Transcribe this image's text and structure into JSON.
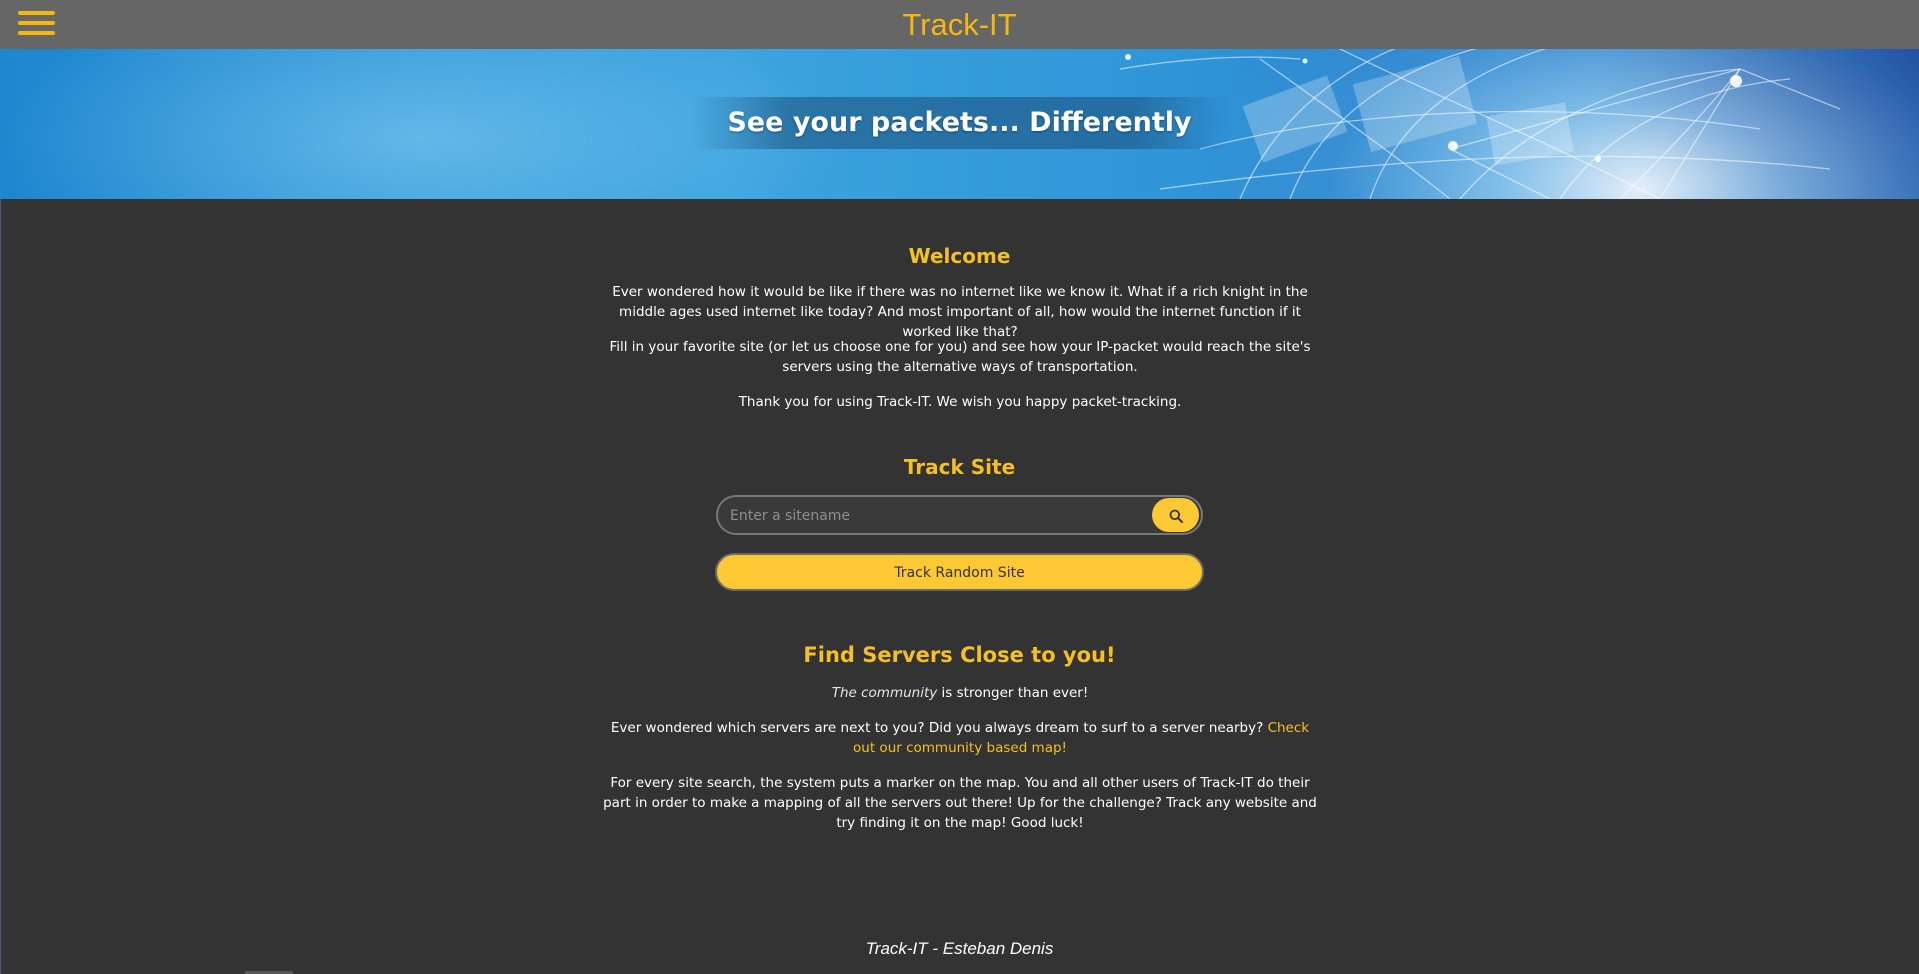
{
  "header": {
    "menu_icon": "hamburger-menu-icon",
    "title": "Track-IT",
    "accent_color": "#f5b80e",
    "background_color": "#666666"
  },
  "banner": {
    "tagline": "See your packets... Differently"
  },
  "welcome": {
    "title": "Welcome",
    "paragraph_1": "Ever wondered how it would be like if there was no internet like we know it. What if a rich knight in the middle ages used internet like today? And most important of all, how would the internet function if it worked like that?",
    "paragraph_2": "Fill in your favorite site (or let us choose one for you) and see how your IP-packet would reach the site's servers using the alternative ways of transportation.",
    "paragraph_3": "Thank you for using Track-IT. We wish you happy packet-tracking."
  },
  "track_site": {
    "title": "Track Site",
    "search_placeholder": "Enter a sitename",
    "search_value": "",
    "search_icon": "search-icon",
    "random_button_label": "Track Random Site",
    "button_color": "#fcc934"
  },
  "find_servers": {
    "title": "Find Servers Close to you!",
    "tagline_italic": "The community",
    "tagline_rest": " is stronger than ever!",
    "paragraph_2_text": "Ever wondered which servers are next to you? Did you always dream to surf to a server nearby? ",
    "paragraph_2_link": "Check out our community based map!",
    "paragraph_3": "For every site search, the system puts a marker on the map. You and all other users of Track-IT do their part in order to make a mapping of all the servers out there! Up for the challenge? Track any website and try finding it on the map! Good luck!"
  },
  "footer": {
    "text": "Track-IT - Esteban Denis"
  },
  "theme": {
    "page_background": "#333333",
    "heading_color": "#f5c026",
    "text_color": "#ffffff"
  }
}
